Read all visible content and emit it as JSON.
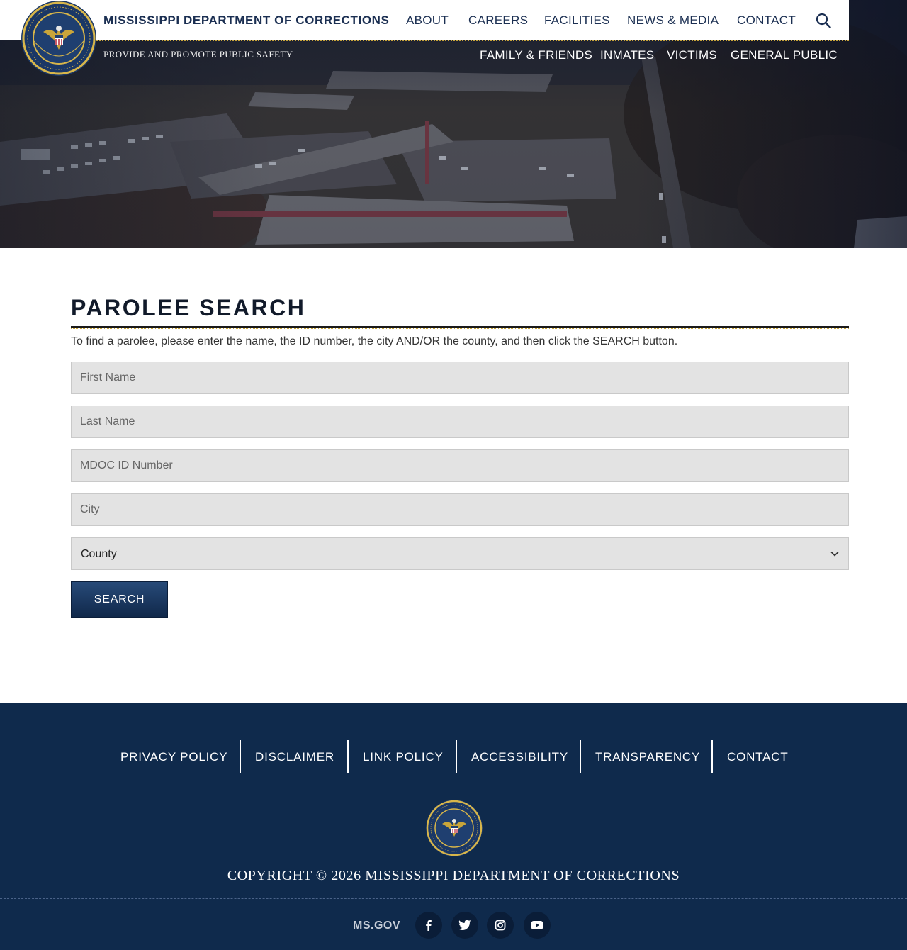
{
  "header": {
    "agency_name": "MISSISSIPPI DEPARTMENT OF CORRECTIONS",
    "tagline": "PROVIDE AND PROMOTE PUBLIC SAFETY",
    "nav_top": [
      "ABOUT",
      "CAREERS",
      "FACILITIES",
      "NEWS & MEDIA",
      "CONTACT"
    ],
    "nav_sub": [
      "FAMILY & FRIENDS",
      "INMATES",
      "VICTIMS",
      "GENERAL PUBLIC"
    ],
    "search_icon": "search-icon",
    "seal_lettering": "MISSISSIPPI DEPARTMENT OF CORRECTIONS"
  },
  "main": {
    "title": "PAROLEE SEARCH",
    "intro": "To find a parolee, please enter the name, the ID number, the city AND/OR the county, and then click the SEARCH button.",
    "fields": {
      "first_name_placeholder": "First Name",
      "last_name_placeholder": "Last Name",
      "mdoc_id_placeholder": "MDOC ID Number",
      "city_placeholder": "City"
    },
    "county_select": "County",
    "search_button": "SEARCH"
  },
  "footer": {
    "links": [
      "PRIVACY POLICY",
      "DISCLAIMER",
      "LINK POLICY",
      "ACCESSIBILITY",
      "TRANSPARENCY",
      "CONTACT"
    ],
    "copyright": "COPYRIGHT © 2026 MISSISSIPPI DEPARTMENT OF CORRECTIONS",
    "msgov": "MS.GOV",
    "social_icons": [
      "facebook-icon",
      "twitter-icon",
      "instagram-icon",
      "youtube-icon"
    ]
  },
  "colors": {
    "navy": "#0f2a4c",
    "navy_text": "#1b2f52",
    "gold": "#c9a53a",
    "field_bg": "#e3e3e3"
  }
}
